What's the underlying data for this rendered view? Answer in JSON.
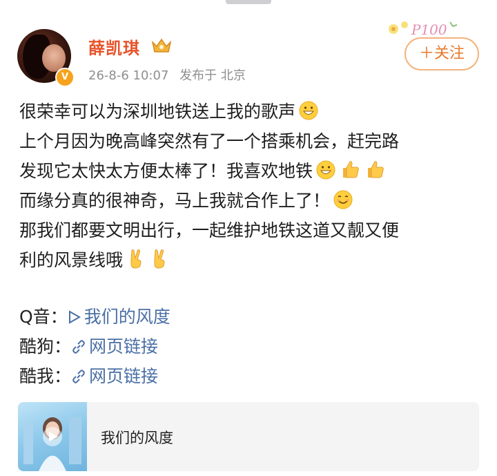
{
  "user": {
    "name": "薛凯琪",
    "time": "26-8-6 10:07",
    "source": "发布于 北京"
  },
  "follow_label": "＋关注",
  "post_lines": [
    {
      "text": "很荣幸可以为深圳地铁送上我的歌声",
      "emoji": [
        "grin-emoji"
      ]
    },
    {
      "text": "上个月因为晚高峰突然有了一个搭乘机会，赶完路",
      "emoji": []
    },
    {
      "text": "发现它太快太方便太棒了！我喜欢地铁",
      "emoji": [
        "grin-emoji",
        "thumbs-up-emoji",
        "thumbs-up-emoji"
      ]
    },
    {
      "text": "而缘分真的很神奇，马上我就合作上了！",
      "emoji": [
        "smile-emoji"
      ]
    },
    {
      "text": "那我们都要文明出行，一起维护地铁这道又靓又便",
      "emoji": []
    },
    {
      "text": "利的风景线哦",
      "emoji": [
        "victory-emoji",
        "victory-emoji"
      ]
    }
  ],
  "links": [
    {
      "label": "Q音：",
      "icon": "play-icon",
      "text": "我们的风度"
    },
    {
      "label": "酷狗：",
      "icon": "link-icon",
      "text": "网页链接"
    },
    {
      "label": "酷我：",
      "icon": "link-icon",
      "text": "网页链接"
    }
  ],
  "card": {
    "title": "我们的风度"
  },
  "colors": {
    "username": "#e8532a",
    "follow": "#e8792a",
    "link": "#4a6fa5",
    "meta": "#8e8e8e"
  }
}
